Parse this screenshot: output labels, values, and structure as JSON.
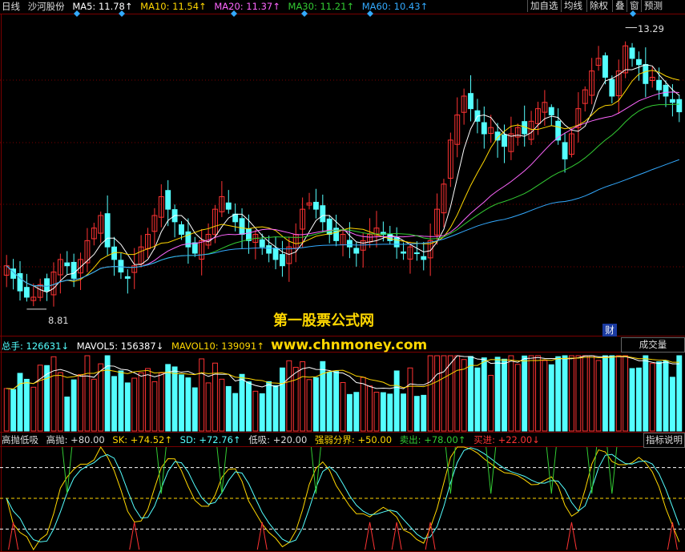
{
  "price_header": {
    "period": "日线",
    "stock": "沙河股份",
    "ma5": {
      "label": "MA5: 11.78↑",
      "color": "#ffffff"
    },
    "ma10": {
      "label": "MA10: 11.54↑",
      "color": "#ffd700"
    },
    "ma20": {
      "label": "MA20: 11.37↑",
      "color": "#ff66ff"
    },
    "ma30": {
      "label": "MA30: 11.21↑",
      "color": "#33cc33"
    },
    "ma60": {
      "label": "MA60: 10.43↑",
      "color": "#33aaff"
    }
  },
  "toolbar": {
    "add_watch": "加自选",
    "ma_line": "均线",
    "ex_rights": "除权",
    "overlay": "叠",
    "window": "窗",
    "forecast": "预测"
  },
  "volume_header": {
    "total": "总手: 126631↓",
    "mavol5": "MAVOL5: 156387↓",
    "mavol10": "MAVOL10: 139091↑",
    "panel_label": "成交量"
  },
  "indicator_header": {
    "name": "高抛低吸",
    "gaopao": "高抛: +80.00",
    "sk": "SK: +74.52↑",
    "sd": "SD: +72.76↑",
    "dixi": "低吸: +20.00",
    "boundary": "强弱分界: +50.00",
    "sell": "卖出: +78.00↑",
    "buy": "买进: +22.00↓",
    "help": "指标说明"
  },
  "watermark": {
    "line1": "第一股票公式网",
    "line2": "www.chnmoney.com"
  },
  "annotations": {
    "high": "13.29",
    "low": "8.81",
    "finance_marker": "财"
  },
  "colors": {
    "up": "#ff3333",
    "down": "#54ffff",
    "grid": "#7a0000",
    "sell_line": "#33cc33",
    "buy_line": "#ff3333"
  },
  "chart_data": {
    "type": "candlestick",
    "price": {
      "ylim": [
        8.4,
        13.5
      ],
      "high_mark": 13.29,
      "low_mark": 8.81,
      "closes": [
        9.5,
        9.3,
        9.1,
        9.0,
        9.0,
        9.2,
        9.1,
        9.4,
        9.6,
        9.5,
        9.3,
        9.6,
        9.9,
        10.1,
        10.3,
        9.8,
        9.6,
        9.4,
        9.3,
        9.5,
        9.8,
        10.0,
        10.3,
        10.6,
        10.4,
        10.2,
        10.0,
        9.8,
        9.7,
        9.9,
        10.0,
        10.4,
        10.6,
        10.4,
        10.2,
        10.0,
        9.9,
        10.0,
        9.8,
        9.7,
        9.6,
        9.5,
        9.8,
        10.0,
        10.4,
        10.5,
        10.4,
        10.2,
        10.0,
        9.9,
        10.0,
        9.8,
        9.7,
        9.9,
        10.0,
        10.1,
        10.0,
        9.9,
        9.8,
        9.7,
        9.8,
        9.7,
        9.6,
        9.9,
        10.4,
        10.8,
        11.5,
        11.9,
        12.2,
        12.0,
        11.8,
        11.6,
        11.7,
        11.5,
        11.4,
        11.6,
        11.7,
        11.6,
        11.8,
        12.0,
        12.1,
        11.9,
        11.5,
        11.2,
        11.6,
        12.0,
        12.3,
        12.6,
        12.8,
        12.5,
        12.2,
        12.6,
        13.0,
        12.8,
        12.7,
        12.4,
        12.5,
        12.3,
        12.2,
        12.1,
        11.95
      ]
    },
    "volume": {
      "last": 126631,
      "mavol5": 156387,
      "mavol10": 139091
    },
    "indicator": {
      "gaopao": 80.0,
      "sk": 74.52,
      "sd": 72.76,
      "dixi": 20.0,
      "boundary": 50.0,
      "sell": 78.0,
      "buy": 22.0,
      "ylim": [
        0,
        100
      ]
    }
  }
}
